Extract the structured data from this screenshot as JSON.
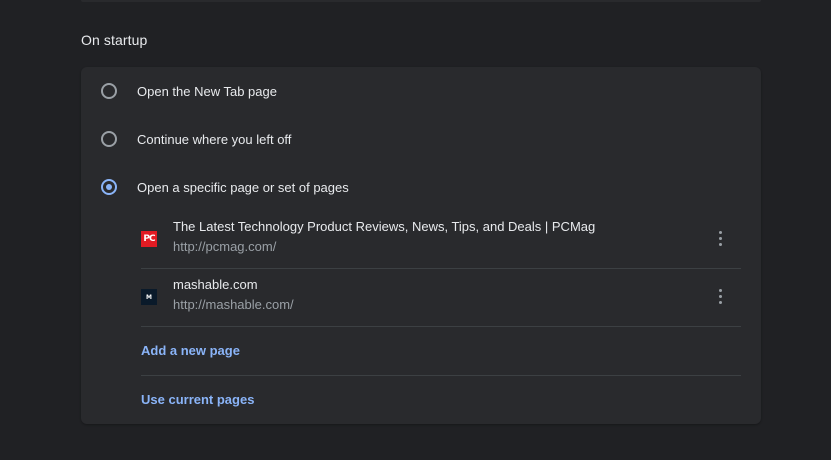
{
  "section": {
    "title": "On startup"
  },
  "startup_options": [
    {
      "label": "Open the New Tab page",
      "checked": false
    },
    {
      "label": "Continue where you left off",
      "checked": false
    },
    {
      "label": "Open a specific page or set of pages",
      "checked": true
    }
  ],
  "pages": [
    {
      "title": "The Latest Technology Product Reviews, News, Tips, and Deals | PCMag",
      "url": "http://pcmag.com/",
      "favicon_text": "PC",
      "icon": "pcmag-favicon-icon"
    },
    {
      "title": "mashable.com",
      "url": "http://mashable.com/",
      "favicon_text": "M",
      "icon": "mashable-favicon-icon"
    }
  ],
  "actions": {
    "add_new_page": "Add a new page",
    "use_current_pages": "Use current pages"
  },
  "colors": {
    "background": "#202124",
    "card": "#292a2d",
    "accent": "#8ab4f8",
    "text_primary": "#e8eaed",
    "text_secondary": "#9aa0a6"
  }
}
